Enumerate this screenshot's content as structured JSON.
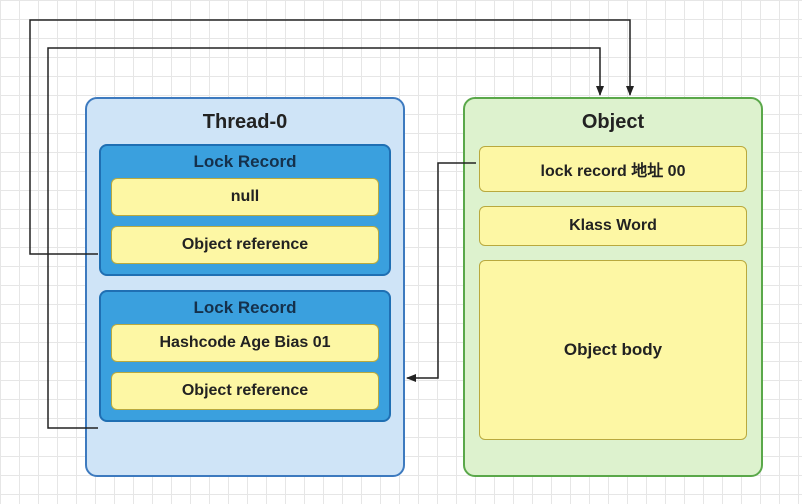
{
  "thread": {
    "title": "Thread-0",
    "lock_records": [
      {
        "title": "Lock Record",
        "mark_word": "null",
        "obj_ref": "Object reference"
      },
      {
        "title": "Lock Record",
        "mark_word": "Hashcode Age Bias 01",
        "obj_ref": "Object reference"
      }
    ]
  },
  "object": {
    "title": "Object",
    "mark_word": "lock record 地址 00",
    "klass": "Klass Word",
    "body": "Object body"
  },
  "diagram": {
    "edges": [
      {
        "from": "lock-record-0.obj_ref",
        "to": "object",
        "via": "top-long"
      },
      {
        "from": "lock-record-1.obj_ref",
        "to": "object",
        "via": "top-short"
      },
      {
        "from": "object.mark_word",
        "to": "lock-record-1",
        "via": "under"
      }
    ]
  }
}
